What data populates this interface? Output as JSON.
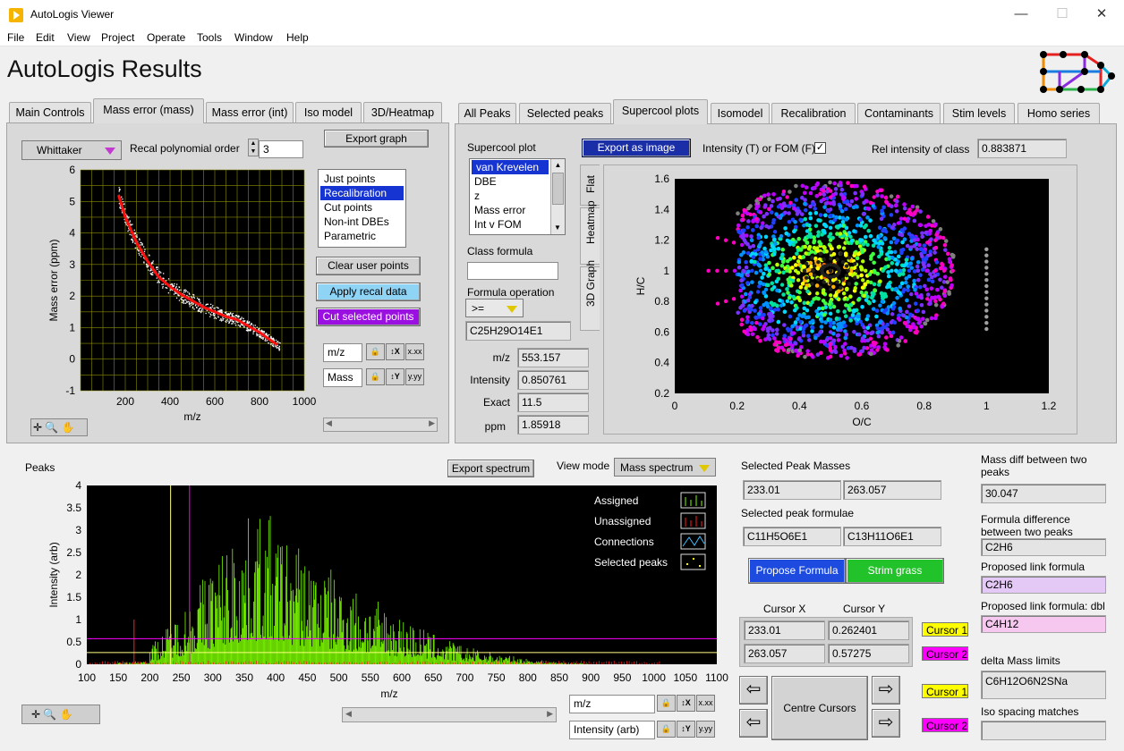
{
  "window": {
    "title": "AutoLogis Viewer",
    "min": "—",
    "max": "☐",
    "close": "✕"
  },
  "menu": [
    "File",
    "Edit",
    "View",
    "Project",
    "Operate",
    "Tools",
    "Window",
    "Help"
  ],
  "page_title": "AutoLogis Results",
  "left_tabs": [
    "Main Controls",
    "Mass error (mass)",
    "Mass error (int)",
    "Iso model",
    "3D/Heatmap"
  ],
  "right_tabs": [
    "All Peaks",
    "Selected peaks",
    "Supercool plots",
    "Isomodel",
    "Recalibration",
    "Contaminants",
    "Stim levels",
    "Homo series"
  ],
  "mass_error": {
    "smoother": "Whittaker",
    "recal_label": "Recal polynomial order",
    "recal_order": "3",
    "export_graph": "Export graph",
    "plot_options": [
      "Just points",
      "Recalibration",
      "Cut points",
      "Non-int DBEs",
      "Parametric"
    ],
    "plot_selected": "Recalibration",
    "clear_user_points": "Clear user points",
    "apply_recal": "Apply recal data",
    "cut_selected": "Cut selected points",
    "x_axis_name": "m/z",
    "y_axis_name": "Mass",
    "x_icon_text": "x.xx",
    "y_icon_text": "y.yy"
  },
  "supercool": {
    "plot_label": "Supercool plot",
    "plot_options": [
      "van Krevelen",
      "DBE",
      "z",
      "Mass error",
      "Int v FOM"
    ],
    "plot_selected": "van Krevelen",
    "export_image": "Export as image",
    "intensity_fom_label": "Intensity (T) or FOM (F)",
    "intensity_fom_checked": true,
    "rel_intensity_label": "Rel intensity of class",
    "rel_intensity_value": "0.883871",
    "class_formula_label": "Class formula",
    "class_formula_value": "",
    "formula_op_label": "Formula operation",
    "formula_op_value": ">=",
    "formula_result": "C25H29O14E1",
    "readouts": [
      {
        "label": "m/z",
        "value": "553.157"
      },
      {
        "label": "Intensity",
        "value": "0.850761"
      },
      {
        "label": "Exact",
        "value": "11.5"
      },
      {
        "label": "ppm",
        "value": "1.85918"
      }
    ],
    "view_tabs": [
      "Flat",
      "Heatmap",
      "3D Graph"
    ]
  },
  "peaks": {
    "label": "Peaks",
    "export_spectrum": "Export spectrum",
    "view_mode_label": "View mode",
    "view_mode_value": "Mass spectrum",
    "legend": [
      "Assigned",
      "Unassigned",
      "Connections",
      "Selected peaks"
    ],
    "x_axis_name": "m/z",
    "y_axis_name": "Intensity (arb)",
    "x_icon_text": "x.xx",
    "y_icon_text": "y.yy"
  },
  "selected": {
    "masses_label": "Selected Peak Masses",
    "masses": [
      "233.01",
      "263.057"
    ],
    "formulae_label": "Selected peak formulae",
    "formulae": [
      "C11H5O6E1",
      "C13H11O6E1"
    ],
    "propose_formula": "Propose Formula",
    "strim_grass": "Strim grass",
    "cursor_x_label": "Cursor X",
    "cursor_y_label": "Cursor Y",
    "cursors": [
      {
        "name": "Cursor 1",
        "x": "233.01",
        "y": "0.262401",
        "color": "#ffff00"
      },
      {
        "name": "Cursor 2",
        "x": "263.057",
        "y": "0.57275",
        "color": "#ff00ff"
      }
    ],
    "centre_cursors": "Centre Cursors"
  },
  "info": {
    "mass_diff_label": "Mass diff between two peaks",
    "mass_diff_value": "30.047",
    "formula_diff_label": "Formula difference between two peaks",
    "formula_diff_value": "C2H6",
    "proposed_link_label": "Proposed link formula",
    "proposed_link_value": "C2H6",
    "proposed_link_dbl_label": "Proposed link formula: dbl",
    "proposed_link_dbl_value": "C4H12",
    "delta_mass_label": "delta Mass limits",
    "delta_mass_value": "C6H12O6N2SNa",
    "iso_spacing_label": "Iso spacing matches",
    "iso_spacing_value": ""
  },
  "chart_data": [
    {
      "type": "scatter",
      "title": "",
      "xlabel": "m/z",
      "ylabel": "Mass error (ppm)",
      "xlim": [
        0,
        1000
      ],
      "ylim": [
        -1,
        6
      ],
      "xticks": [
        "200",
        "400",
        "600",
        "800",
        "1000"
      ],
      "yticks": [
        "-1",
        "0",
        "1",
        "2",
        "3",
        "4",
        "5",
        "6"
      ],
      "grid": true,
      "series": [
        {
          "x": [
            170,
            200,
            250,
            300,
            350,
            400,
            450,
            500,
            550,
            600,
            650,
            700,
            750,
            800,
            850,
            880
          ],
          "y": [
            5.2,
            4.5,
            3.7,
            3.1,
            2.6,
            2.3,
            2.05,
            1.85,
            1.65,
            1.5,
            1.35,
            1.25,
            1.05,
            0.85,
            0.6,
            0.45
          ]
        }
      ]
    },
    {
      "type": "scatter",
      "title": "",
      "xlabel": "O/C",
      "ylabel": "H/C",
      "xlim": [
        0,
        1.2
      ],
      "ylim": [
        0.2,
        1.6
      ],
      "xticks": [
        "0",
        "0.2",
        "0.4",
        "0.6",
        "0.8",
        "1",
        "1.2"
      ],
      "yticks": [
        "0.2",
        "0.4",
        "0.6",
        "0.8",
        "1",
        "1.2",
        "1.4",
        "1.6"
      ]
    },
    {
      "type": "bar",
      "title": "",
      "xlabel": "m/z",
      "ylabel": "Intensity (arb)",
      "xlim": [
        100,
        1100
      ],
      "ylim": [
        0,
        4
      ],
      "xticks": [
        "100",
        "150",
        "200",
        "250",
        "300",
        "350",
        "400",
        "450",
        "500",
        "550",
        "600",
        "650",
        "700",
        "750",
        "800",
        "850",
        "900",
        "950",
        "1000",
        "1050",
        "1100"
      ],
      "yticks": [
        "0",
        "0.5",
        "1",
        "1.5",
        "2",
        "2.5",
        "3",
        "3.5",
        "4"
      ],
      "x": [
        200,
        250,
        300,
        350,
        380,
        400,
        450,
        500,
        550,
        600,
        650,
        700,
        750,
        800,
        850,
        900
      ],
      "values": [
        0.4,
        1.2,
        2.4,
        3.2,
        3.6,
        3.1,
        2.6,
        2.0,
        1.5,
        1.1,
        0.7,
        0.4,
        0.25,
        0.12,
        0.05,
        0.02
      ],
      "cursors": [
        {
          "x": 233.01,
          "y": 0.262401
        },
        {
          "x": 263.057,
          "y": 0.57275
        }
      ]
    }
  ],
  "colors": {
    "accent": "#1634d2",
    "cursor1": "#ffff00",
    "cursor2": "#ff00ff",
    "apply": "#8fd3f5",
    "cut": "#9a10e0",
    "propose": "#1d4be0",
    "strim": "#22c22a"
  }
}
